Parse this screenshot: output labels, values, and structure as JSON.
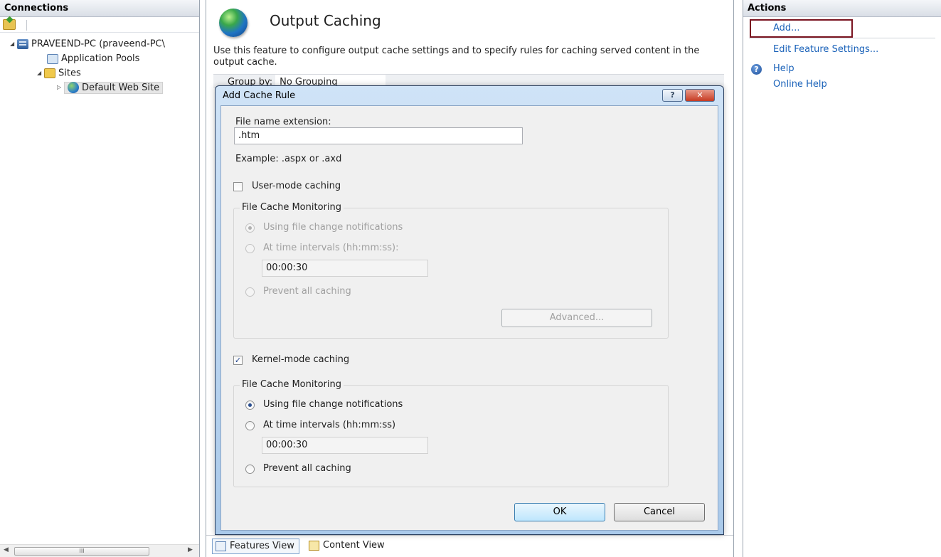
{
  "connections": {
    "header": "Connections",
    "tree": {
      "server": "PRAVEEND-PC (praveend-PC\\",
      "app_pools": "Application Pools",
      "sites": "Sites",
      "default_site": "Default Web Site"
    },
    "hscroll_grip": "III"
  },
  "feature": {
    "title": "Output Caching",
    "description": "Use this feature to configure output cache settings and to specify rules for caching served content in the output cache.",
    "group_by_label": "Group by:",
    "group_by_value": "No Grouping",
    "tabs": {
      "features_view": "Features View",
      "content_view": "Content View"
    }
  },
  "actions": {
    "header": "Actions",
    "add": "Add...",
    "edit_feature_settings": "Edit Feature Settings...",
    "help": "Help",
    "online_help": "Online Help"
  },
  "dialog": {
    "title": "Add Cache Rule",
    "help_btn": "?",
    "close_btn": "✕",
    "file_ext_label": "File name extension:",
    "file_ext_value": ".htm",
    "example": "Example: .aspx or .axd",
    "user_mode": {
      "label": "User-mode caching",
      "checked": false,
      "group_label": "File Cache Monitoring",
      "opt_notifications": "Using file change notifications",
      "opt_intervals": "At time intervals (hh:mm:ss):",
      "interval_value": "00:00:30",
      "opt_prevent": "Prevent all caching",
      "advanced_btn": "Advanced..."
    },
    "kernel_mode": {
      "label": "Kernel-mode caching",
      "checked": true,
      "group_label": "File Cache Monitoring",
      "opt_notifications": "Using file change notifications",
      "opt_intervals": "At time intervals (hh:mm:ss)",
      "interval_value": "00:00:30",
      "opt_prevent": "Prevent all caching"
    },
    "ok_btn": "OK",
    "cancel_btn": "Cancel"
  },
  "colors": {
    "link": "#1a62b9",
    "highlight_box": "#7a1420",
    "dialog_frame": "#a9c9ea"
  }
}
